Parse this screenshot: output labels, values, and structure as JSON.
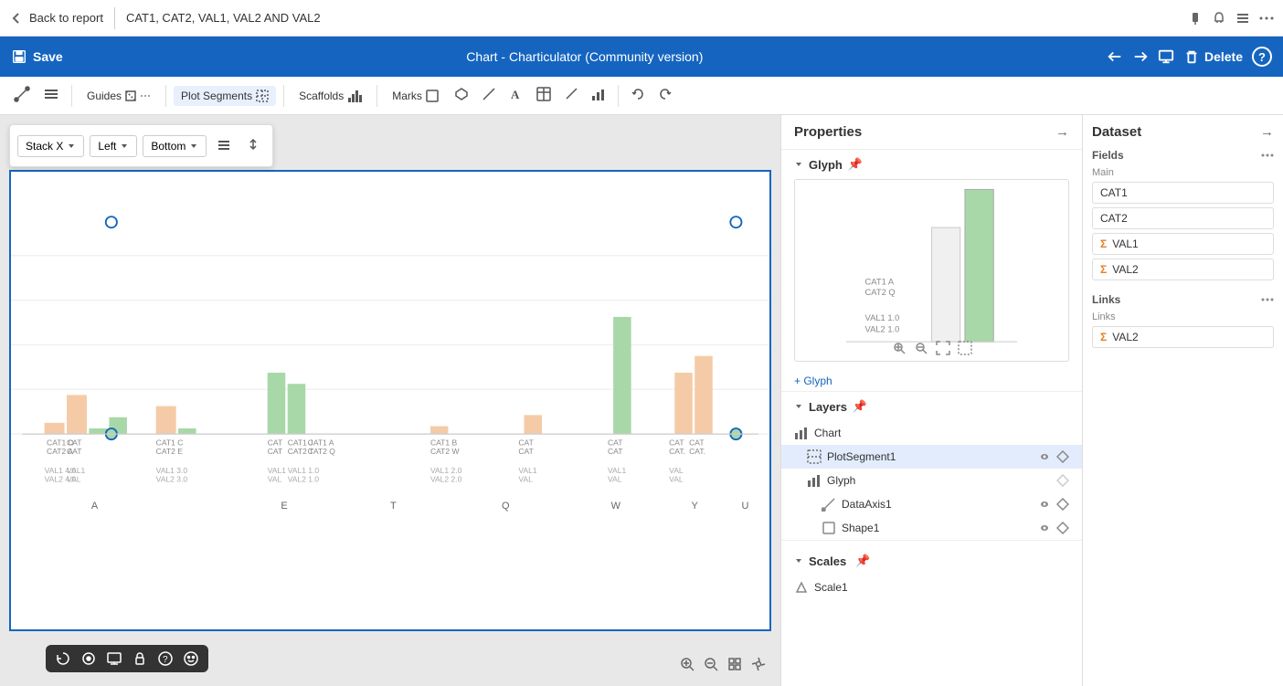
{
  "topBar": {
    "backLabel": "Back to report",
    "title": "CAT1, CAT2, VAL1, VAL2 AND VAL2"
  },
  "headerBar": {
    "saveLabel": "Save",
    "title": "Chart - Charticulator (Community version)",
    "deleteLabel": "Delete",
    "helpLabel": "?"
  },
  "toolbar": {
    "guides": "Guides",
    "plotSegments": "Plot Segments",
    "scaffolds": "Scaffolds",
    "marks": "Marks"
  },
  "dropdownToolbar": {
    "stackX": "Stack X",
    "left": "Left",
    "bottom": "Bottom"
  },
  "properties": {
    "title": "Properties",
    "glyphSection": "Glyph",
    "glyphLabels": {
      "cat1a": "CAT1 A",
      "cat2q": "CAT2 Q",
      "val1": "VAL1 1.0",
      "val2": "VAL2 1.0"
    },
    "addGlyph": "+ Glyph",
    "layersSection": "Layers",
    "layers": {
      "chart": "Chart",
      "plotSegment": "PlotSegment1",
      "glyph": "Glyph",
      "dataAxis": "DataAxis1",
      "shape": "Shape1"
    }
  },
  "dataset": {
    "title": "Dataset",
    "fieldsTitle": "Fields",
    "mainLabel": "Main",
    "fields": [
      "CAT1",
      "CAT2",
      "VAL1",
      "VAL2"
    ],
    "linksTitle": "Links",
    "linksLabel": "Links",
    "linksField": "VAL2",
    "scalesTitle": "Scales",
    "scaleItem": "Scale1"
  },
  "xLabels": [
    "A",
    "E",
    "T",
    "Q",
    "W",
    "Y",
    "U"
  ],
  "icons": {
    "chevronDown": "▾",
    "pin": "📌",
    "eye": "👁",
    "diamond": "◇",
    "chart": "▦",
    "barChart": "▥",
    "sigma": "Σ",
    "undo": "↩",
    "redo": "↪",
    "expand": "→",
    "collapse": "←"
  }
}
